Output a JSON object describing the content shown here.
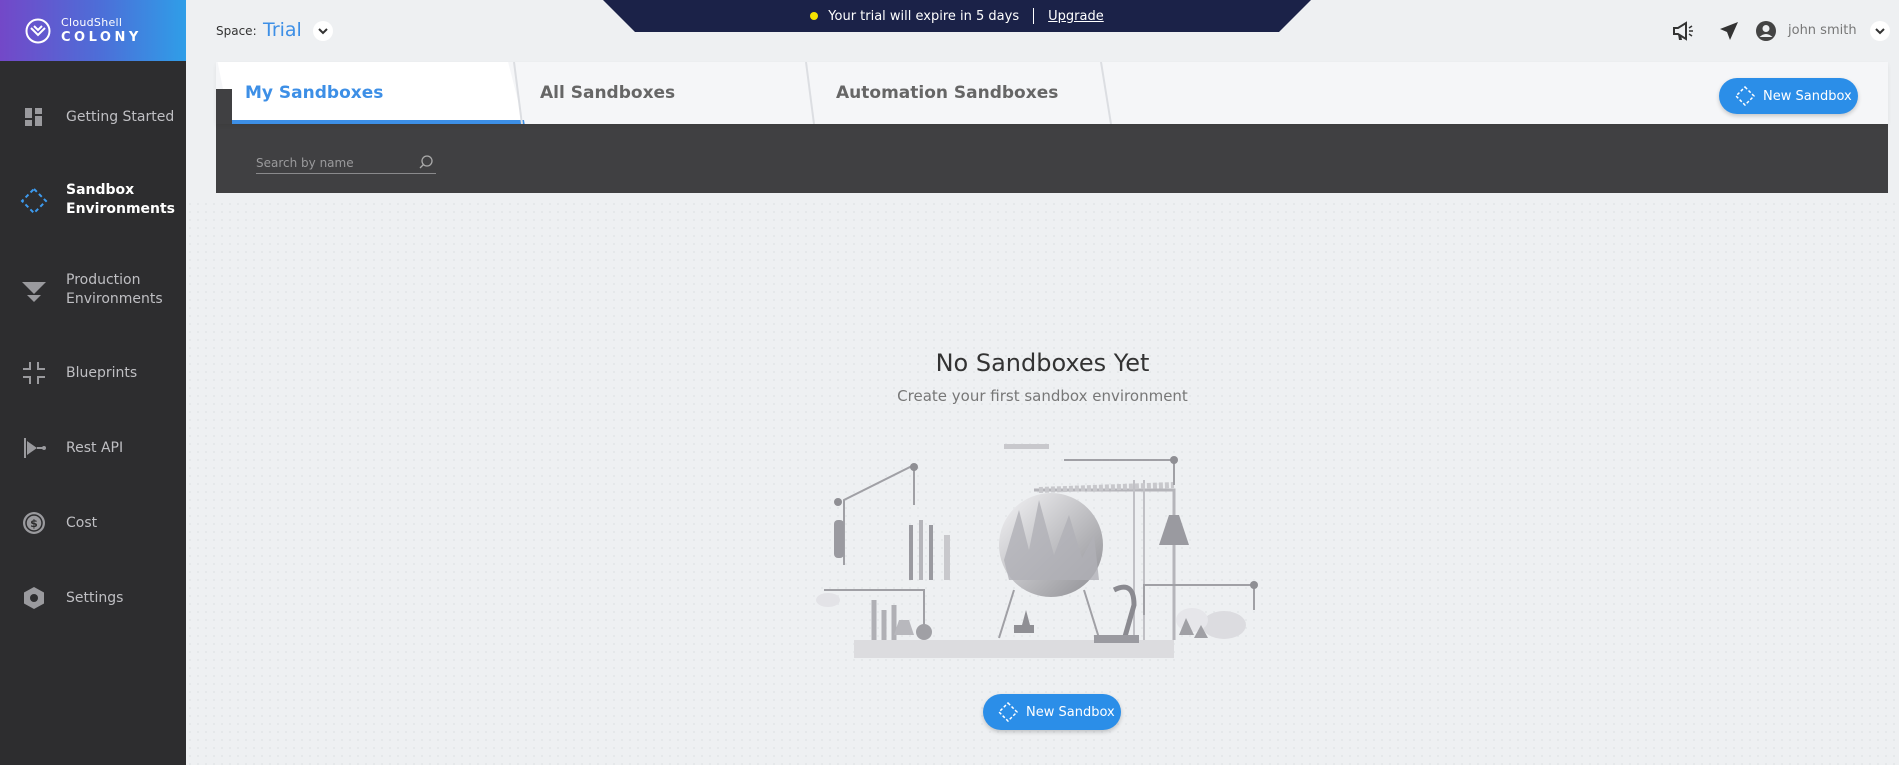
{
  "brand": {
    "top": "CloudShell",
    "bottom": "COLONY"
  },
  "sidebar": {
    "items": [
      {
        "label": "Getting Started",
        "icon": "dashboard-icon"
      },
      {
        "label": "Sandbox Environments",
        "icon": "sandbox-icon",
        "active": true
      },
      {
        "label": "Production Environments",
        "icon": "funnel-icon"
      },
      {
        "label": "Blueprints",
        "icon": "blueprint-icon"
      },
      {
        "label": "Rest API",
        "icon": "api-icon"
      },
      {
        "label": "Cost",
        "icon": "dollar-icon"
      },
      {
        "label": "Settings",
        "icon": "hexagon-gear-icon"
      }
    ]
  },
  "header": {
    "space_label": "Space:",
    "space_value": "Trial",
    "trial_message": "Your trial will expire in 5 days",
    "upgrade_label": "Upgrade",
    "user_name": "john smith"
  },
  "tabs": [
    {
      "label": "My Sandboxes",
      "active": true
    },
    {
      "label": "All Sandboxes"
    },
    {
      "label": "Automation Sandboxes"
    }
  ],
  "new_sandbox_label": "New Sandbox",
  "search": {
    "placeholder": "Search by name",
    "value": ""
  },
  "empty_state": {
    "title": "No Sandboxes Yet",
    "subtitle": "Create your first sandbox environment",
    "button_label": "New Sandbox"
  },
  "colors": {
    "accent": "#2b8ee8",
    "sidebar": "#2d2d2f",
    "banner": "#1b2248",
    "panel_dark": "#404042"
  }
}
